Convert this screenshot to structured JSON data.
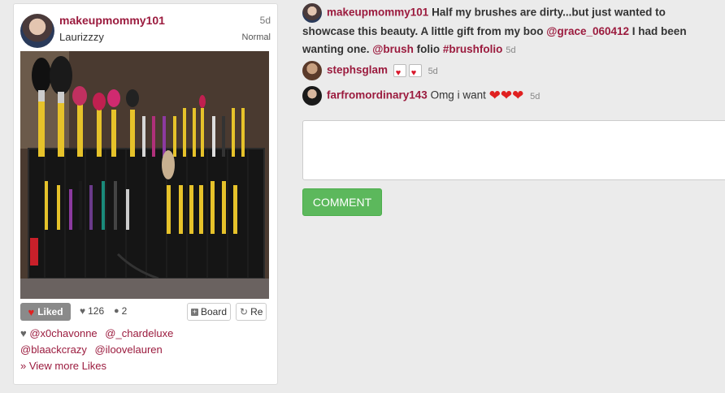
{
  "post": {
    "username": "makeupmommy101",
    "caption": "Laurizzzy",
    "time": "5d",
    "filter": "Normal",
    "liked_label": "Liked",
    "likes_count": "126",
    "comments_count": "2",
    "board_label": "Board",
    "repost_label": "Re",
    "likers": [
      "@x0chavonne",
      "@_chardeluxe",
      "@blaackcrazy",
      "@iloovelauren"
    ],
    "view_more": "» View more Likes"
  },
  "comments": {
    "main": {
      "username": "makeupmommy101",
      "text_1": " Half my brushes are dirty...but just wanted to showcase this beauty. A little gift from my boo ",
      "mention": "@grace_060412",
      "text_2": " I had been wanting one. ",
      "tag_1": "@brush",
      "text_3": " folio ",
      "tag_2": "#brushfolio",
      "time": "5d"
    },
    "c1": {
      "username": "stephsglam",
      "time": "5d"
    },
    "c2": {
      "username": "farfromordinary143",
      "text": "Omg i want",
      "time": "5d"
    }
  },
  "comment_button": "COMMENT",
  "icons": {
    "heart": "heart-icon",
    "comment": "speech-bubble-icon",
    "board": "plus-square-icon",
    "repost": "repost-icon"
  }
}
